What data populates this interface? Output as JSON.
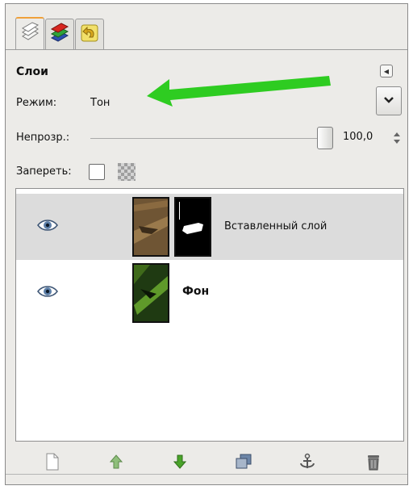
{
  "tabs": [
    {
      "icon": "layers-tab-icon",
      "active": true
    },
    {
      "icon": "channels-tab-icon",
      "active": false
    },
    {
      "icon": "undo-history-tab-icon",
      "active": false
    }
  ],
  "dialog": {
    "title": "Слои"
  },
  "mode": {
    "label": "Режим:",
    "value": "Тон"
  },
  "opacity": {
    "label": "Непрозр.:",
    "value": "100,0",
    "fraction": 1.0
  },
  "lock": {
    "label": "Запереть:",
    "pixels_locked": false
  },
  "layers": [
    {
      "name": "Вставленный слой",
      "visible": true,
      "selected": true,
      "has_mask": true
    },
    {
      "name": "Фон",
      "visible": true,
      "selected": false,
      "has_mask": false
    }
  ],
  "bottom_buttons": [
    "new-layer-icon",
    "raise-layer-icon",
    "lower-layer-icon",
    "duplicate-layer-icon",
    "anchor-layer-icon",
    "delete-layer-icon"
  ],
  "annotation": {
    "arrow_color": "#2ecc21"
  }
}
